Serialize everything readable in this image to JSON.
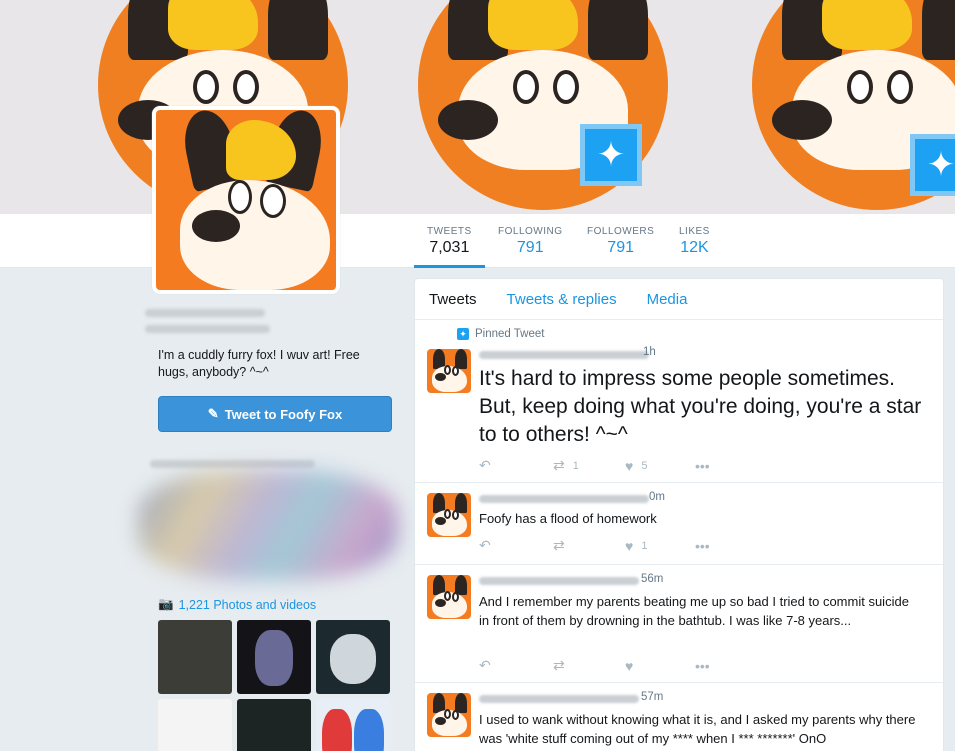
{
  "colors": {
    "accent": "#1b95e0",
    "button": "#3b94d9",
    "fox_orange": "#f47b20",
    "background": "#e6ecf0"
  },
  "banner": {
    "badge_icon": "twitter-bird-icon"
  },
  "stats": [
    {
      "label": "TWEETS",
      "value": "7,031"
    },
    {
      "label": "FOLLOWING",
      "value": "791"
    },
    {
      "label": "FOLLOWERS",
      "value": "791"
    },
    {
      "label": "LIKES",
      "value": "12K"
    }
  ],
  "profile": {
    "bio": "I'm a cuddly furry fox! I wuv art! Free hugs, anybody? ^~^",
    "tweet_to_label": "Tweet to Foofy Fox",
    "photos_label": "1,221 Photos and videos"
  },
  "tabs": [
    {
      "label": "Tweets"
    },
    {
      "label": "Tweets & replies"
    },
    {
      "label": "Media"
    }
  ],
  "tweets": [
    {
      "pinned_label": "Pinned Tweet",
      "time": "1h",
      "text": "It's hard to impress some people sometimes. But, keep doing what you're doing, you're a star to to others! ^~^",
      "retweets": "1",
      "likes": "5"
    },
    {
      "time": "0m",
      "text": "Foofy has a flood of homework",
      "retweets": "",
      "likes": "1"
    },
    {
      "time": "56m",
      "text": "And I remember my parents beating me up so bad I tried to commit suicide in front of them by drowning in the bathtub. I was like 7-8 years...",
      "retweets": "",
      "likes": ""
    },
    {
      "time": "57m",
      "text": "I used to wank without knowing what it is, and I asked my parents why there was 'white stuff coming out of my **** when I *** *******' OnO",
      "retweets": "",
      "likes": ""
    }
  ]
}
